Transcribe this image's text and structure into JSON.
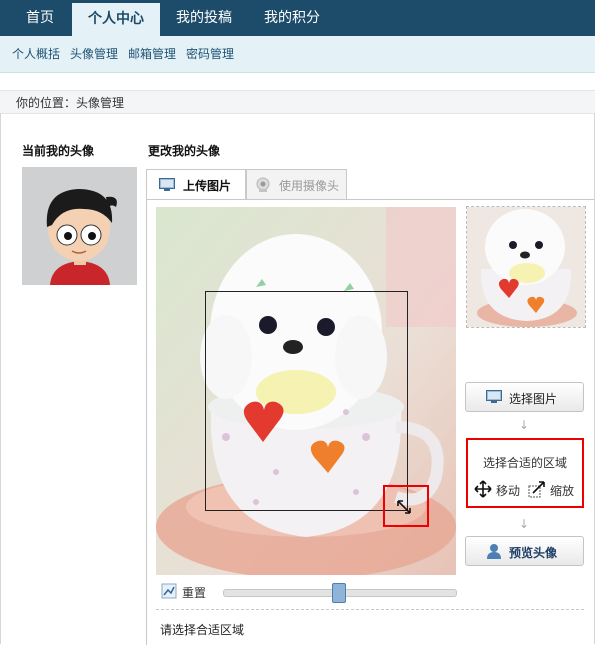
{
  "topnav": {
    "tabs": [
      {
        "label": "首页"
      },
      {
        "label": "个人中心",
        "active": true
      },
      {
        "label": "我的投稿"
      },
      {
        "label": "我的积分"
      }
    ]
  },
  "subnav": {
    "items": [
      {
        "label": "个人概括"
      },
      {
        "label": "头像管理"
      },
      {
        "label": "邮箱管理"
      },
      {
        "label": "密码管理"
      }
    ]
  },
  "breadcrumb": "你的位置：头像管理",
  "current_avatar": {
    "title": "当前我的头像"
  },
  "change_avatar": {
    "title": "更改我的头像",
    "tabs": {
      "upload": "上传图片",
      "camera": "使用摄像头"
    },
    "select_button": "选择图片",
    "tip_title": "选择合适的区域",
    "move_label": "移动",
    "zoom_label": "缩放",
    "preview_button": "预览头像",
    "reset_label": "重置",
    "zoom_level": 0.5,
    "status_text": "请选择合适区域"
  },
  "colors": {
    "nav_bg": "#1d4b6a",
    "subnav_bg": "#e4f1f7",
    "highlight_red": "#e00000"
  }
}
